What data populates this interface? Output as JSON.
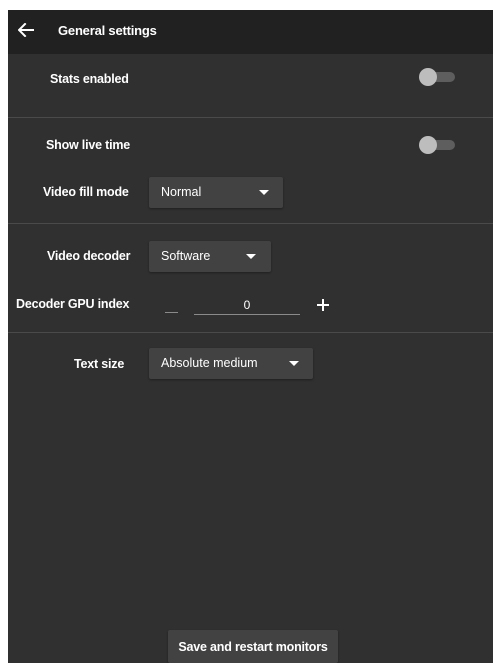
{
  "header": {
    "back_icon": "arrow-left-icon",
    "title": "General settings"
  },
  "settings": {
    "stats_enabled": {
      "label": "Stats enabled",
      "on": false
    },
    "show_live_time": {
      "label": "Show live time",
      "on": false
    },
    "video_fill_mode": {
      "label": "Video fill mode",
      "value": "Normal"
    },
    "video_decoder": {
      "label": "Video decoder",
      "value": "Software"
    },
    "decoder_gpu_index": {
      "label": "Decoder GPU index",
      "value": "0"
    },
    "text_size": {
      "label": "Text size",
      "value": "Absolute medium"
    }
  },
  "footer": {
    "save_label": "Save and restart monitors"
  },
  "colors": {
    "background": "#303030",
    "topbar": "#212121",
    "control": "#424242",
    "toggle_thumb": "#bdbdbd",
    "toggle_track": "#5e5e5e"
  }
}
